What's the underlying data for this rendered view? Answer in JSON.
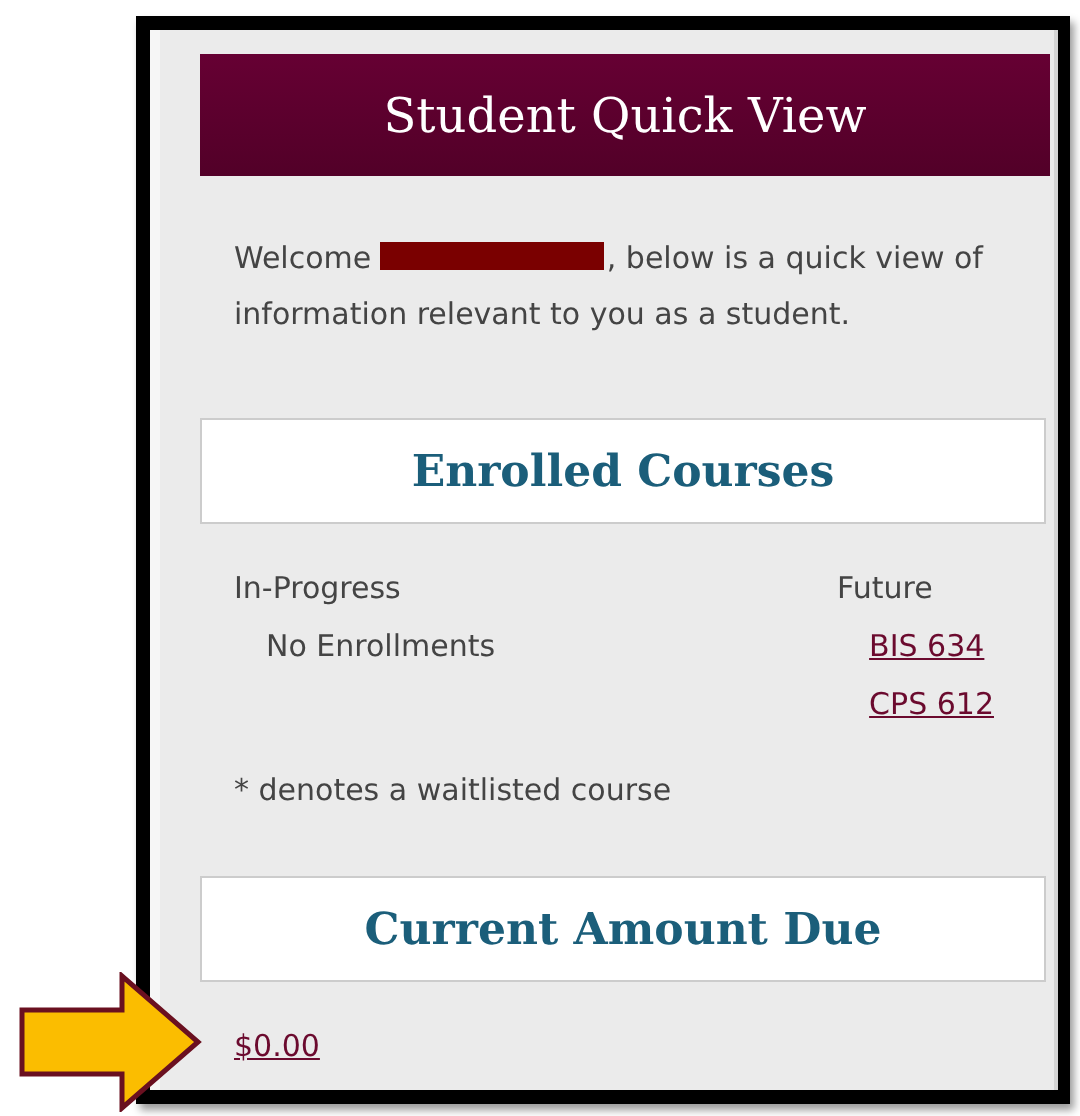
{
  "panel": {
    "title": "Student Quick View",
    "welcome": {
      "before": "Welcome",
      "redacted": true,
      "after": ", below is a quick view of information relevant to you as a student."
    },
    "enrolled": {
      "heading": "Enrolled Courses",
      "columns": [
        {
          "heading": "In-Progress",
          "kind": "plain",
          "items": [
            "No Enrollments"
          ]
        },
        {
          "heading": "Future",
          "kind": "links",
          "items": [
            "BIS 634",
            "CPS 612"
          ]
        }
      ],
      "note": "* denotes a waitlisted course"
    },
    "amount_due": {
      "heading": "Current Amount Due",
      "amount": "$0.00"
    }
  },
  "annotation": {
    "kind": "arrow"
  }
}
